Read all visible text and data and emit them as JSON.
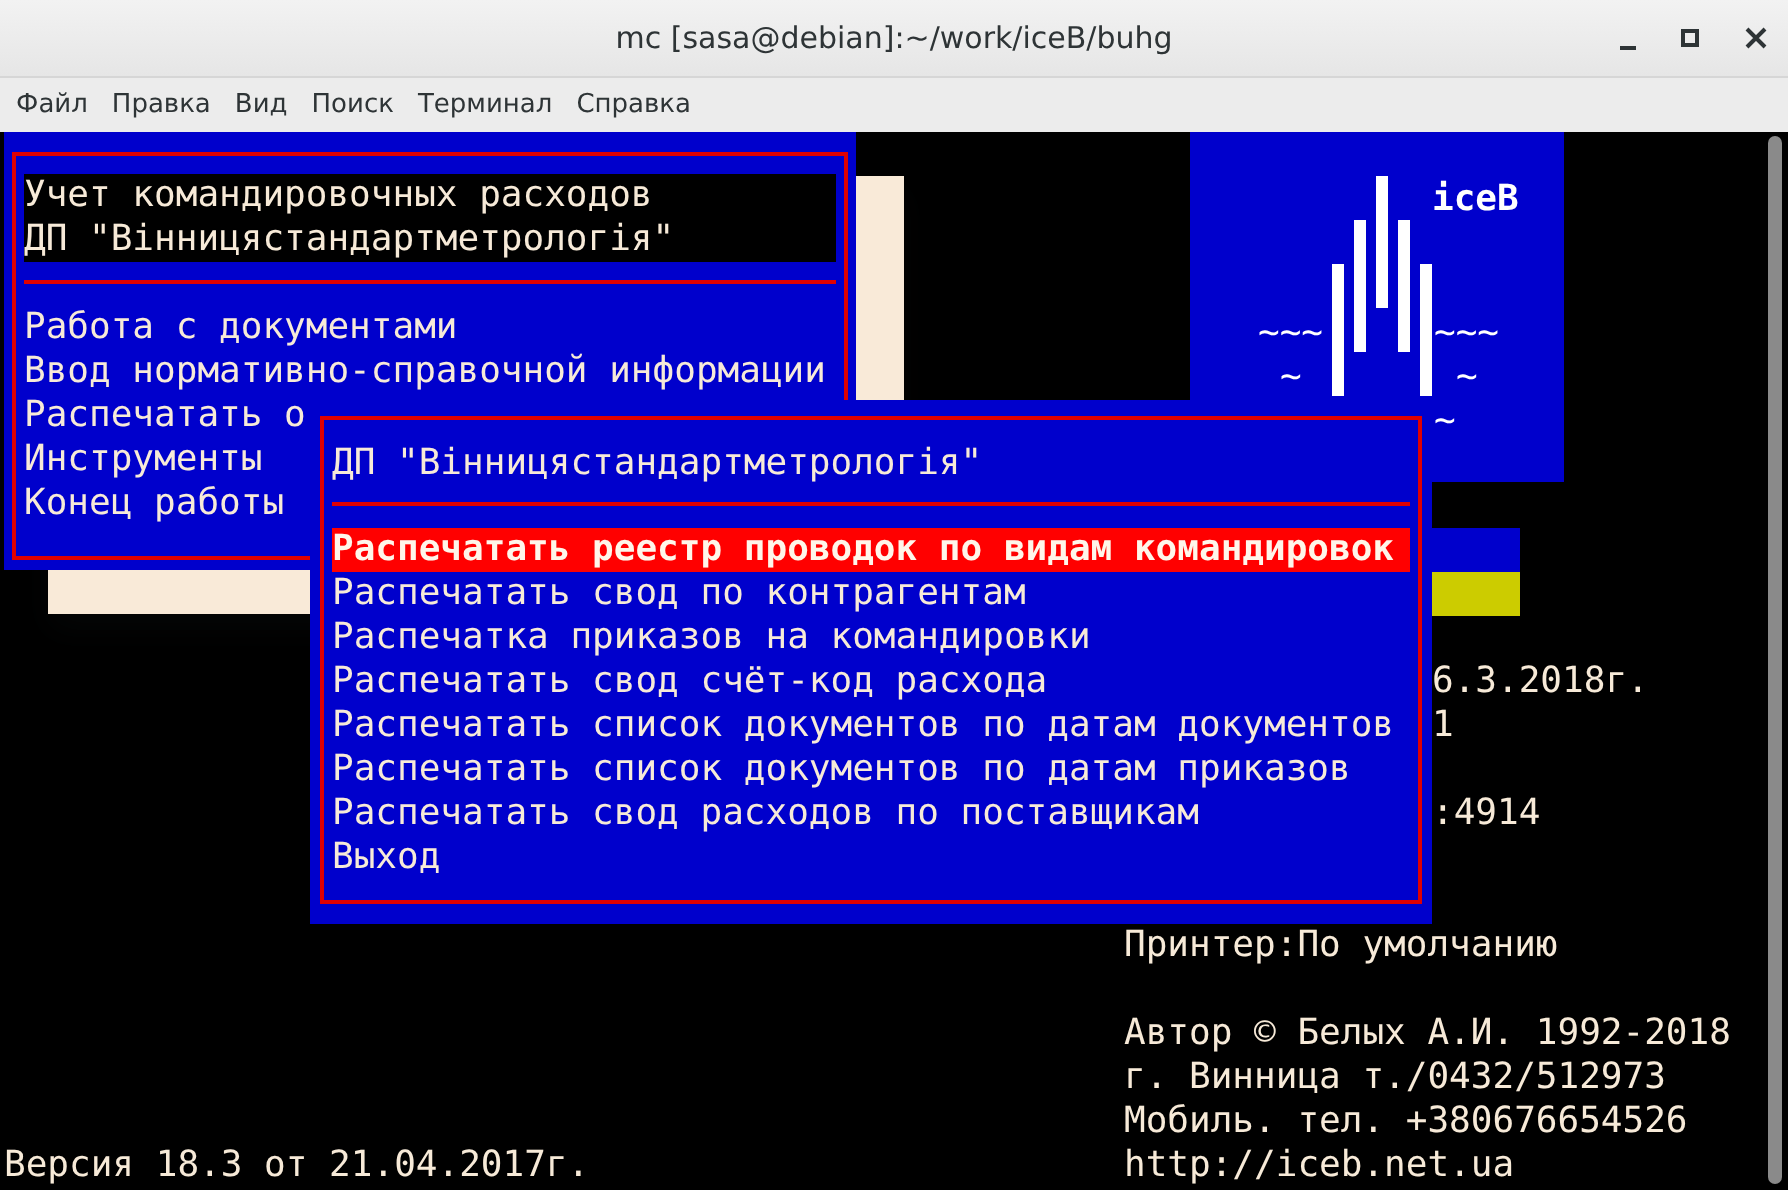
{
  "window": {
    "title": "mc [sasa@debian]:~/work/iceB/buhg"
  },
  "menu": [
    {
      "label": "Файл"
    },
    {
      "label": "Правка"
    },
    {
      "label": "Вид"
    },
    {
      "label": "Поиск"
    },
    {
      "label": "Терминал"
    },
    {
      "label": "Справка"
    }
  ],
  "main_menu": {
    "header": [
      "Учет командировочных расходов",
      "ДП \"Вінницястандартметрологія\""
    ],
    "items": [
      {
        "label": "Работа с документами",
        "selected": false
      },
      {
        "label": "Ввод нормативно-справочной информации",
        "selected": false
      },
      {
        "label": "Распечатать о",
        "selected": false
      },
      {
        "label": "Инструменты",
        "selected": false
      },
      {
        "label": "Конец работы",
        "selected": false
      }
    ]
  },
  "logo": {
    "title": "iceB",
    "waves": [
      "~~~",
      "~~~",
      "~",
      "~",
      "~"
    ]
  },
  "background_lines": [
    "6.3.2018г.",
    "1",
    ":4914",
    "Принтер:По умолчанию",
    "Автор © Белых А.И. 1992-2018",
    "г. Винница т./0432/512973",
    "Мобиль. тел. +380676654526",
    "Версия 18.3 от 21.04.2017г.",
    "http://iceb.net.ua"
  ],
  "dialog": {
    "title": "ДП \"Вінницястандартметрологія\"",
    "items": [
      {
        "label": "Распечатать реестр проводок по видам командировок",
        "selected": true
      },
      {
        "label": "Распечатать свод по контрагентам",
        "selected": false
      },
      {
        "label": "Распечатка приказов на командировки",
        "selected": false
      },
      {
        "label": "Распечатать свод счёт-код расхода",
        "selected": false
      },
      {
        "label": "Распечатать список документов по датам документов",
        "selected": false
      },
      {
        "label": "Распечатать список документов по датам приказов",
        "selected": false
      },
      {
        "label": "Распечатать свод расходов по поставщикам",
        "selected": false
      },
      {
        "label": "Выход",
        "selected": false
      }
    ]
  }
}
